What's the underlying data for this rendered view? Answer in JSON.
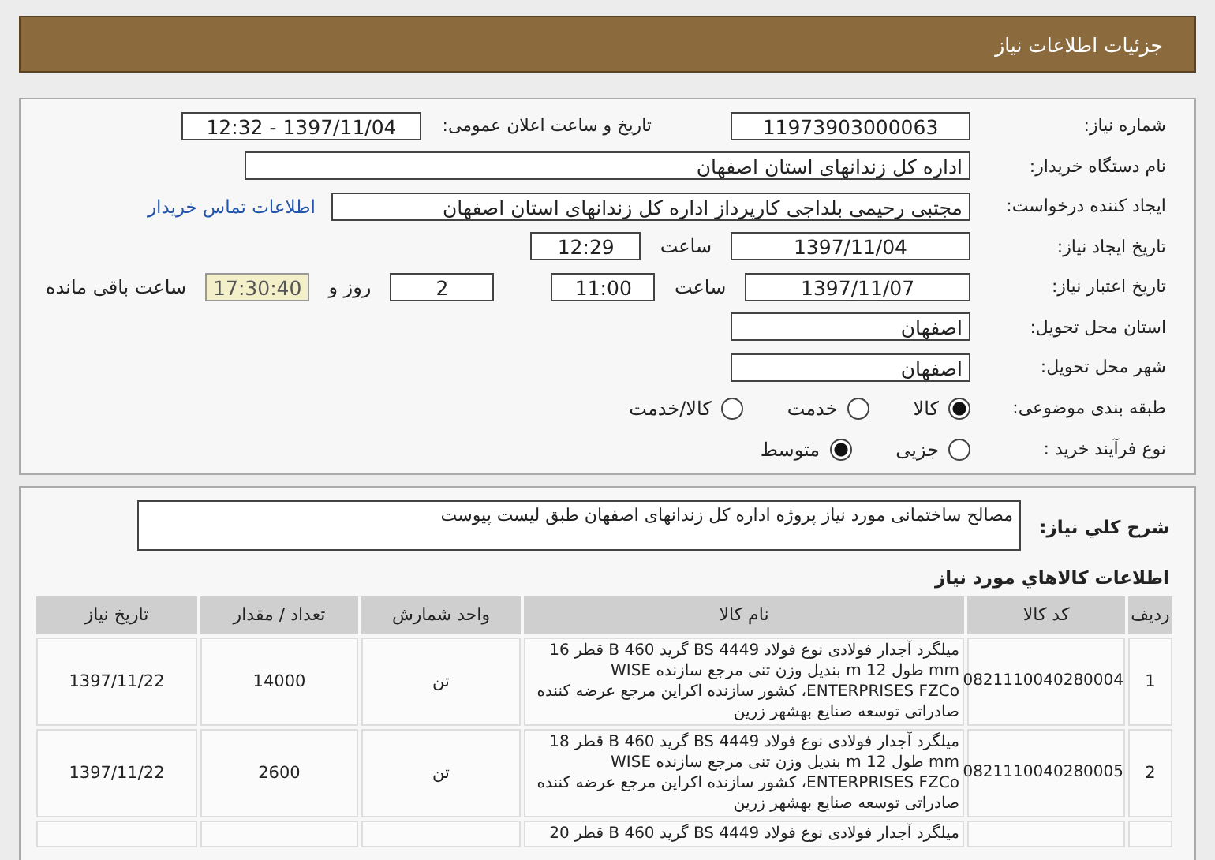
{
  "header": {
    "title": "جزئیات اطلاعات نیاز"
  },
  "need_number": {
    "label": "شماره نیاز:",
    "value": "11973903000063"
  },
  "announce": {
    "label": "تاریخ و ساعت اعلان عمومی:",
    "value": "1397/11/04 - 12:32"
  },
  "buyer": {
    "label": "نام دستگاه خریدار:",
    "value": "اداره کل زندانهای استان اصفهان"
  },
  "requester": {
    "label": "ایجاد کننده درخواست:",
    "value": "مجتبی رحیمی بلداجی کارپرداز اداره کل زندانهای استان اصفهان",
    "link": "اطلاعات تماس خریدار"
  },
  "created": {
    "label": "تاریخ ایجاد نیاز:",
    "date": "1397/11/04",
    "time_label": "ساعت",
    "time": "12:29"
  },
  "validity": {
    "label": "تاریخ اعتبار نیاز:",
    "date": "1397/11/07",
    "time_label": "ساعت",
    "time": "11:00",
    "days": "2",
    "days_label": "روز و",
    "remaining": "17:30:40",
    "remaining_label": "ساعت باقی مانده"
  },
  "province": {
    "label": "استان محل تحویل:",
    "value": "اصفهان"
  },
  "city": {
    "label": "شهر محل تحویل:",
    "value": "اصفهان"
  },
  "category": {
    "label": "طبقه بندی موضوعی:",
    "options": [
      {
        "label": "کالا",
        "selected": true
      },
      {
        "label": "خدمت",
        "selected": false
      },
      {
        "label": "کالا/خدمت",
        "selected": false
      }
    ]
  },
  "process": {
    "label": "نوع فرآیند خرید :",
    "options": [
      {
        "label": "جزیی",
        "selected": false
      },
      {
        "label": "متوسط",
        "selected": true
      }
    ]
  },
  "description": {
    "label": "شرح كلي نياز:",
    "value": "مصالح ساختمانی مورد نیاز پروژه اداره کل زندانهای اصفهان طبق لیست پیوست"
  },
  "items": {
    "title": "اطلاعات كالاهاي مورد نياز",
    "columns": [
      "ردیف",
      "کد کالا",
      "نام کالا",
      "واحد شمارش",
      "تعداد / مقدار",
      "تاریخ نیاز"
    ],
    "rows": [
      {
        "row": "1",
        "code": "0821110040280004",
        "name": "میلگرد آجدار فولادی نوع فولاد BS 4449 گرید B 460 قطر 16 mm طول 12 m بندیل وزن تنی مرجع سازنده WISE ENTERPRISES FZCo، کشور سازنده اکراین مرجع عرضه کننده صادراتی توسعه صنایع بهشهر زرین",
        "unit": "تن",
        "qty": "14000",
        "date": "1397/11/22"
      },
      {
        "row": "2",
        "code": "0821110040280005",
        "name": "میلگرد آجدار فولادی نوع فولاد BS 4449 گرید B 460 قطر 18 mm طول 12 m بندیل وزن تنی مرجع سازنده WISE ENTERPRISES FZCo، کشور سازنده اکراین مرجع عرضه کننده صادراتی توسعه صنایع بهشهر زرین",
        "unit": "تن",
        "qty": "2600",
        "date": "1397/11/22"
      },
      {
        "name": "میلگرد آجدار فولادی نوع فولاد BS 4449 گرید B 460 قطر 20"
      }
    ]
  }
}
